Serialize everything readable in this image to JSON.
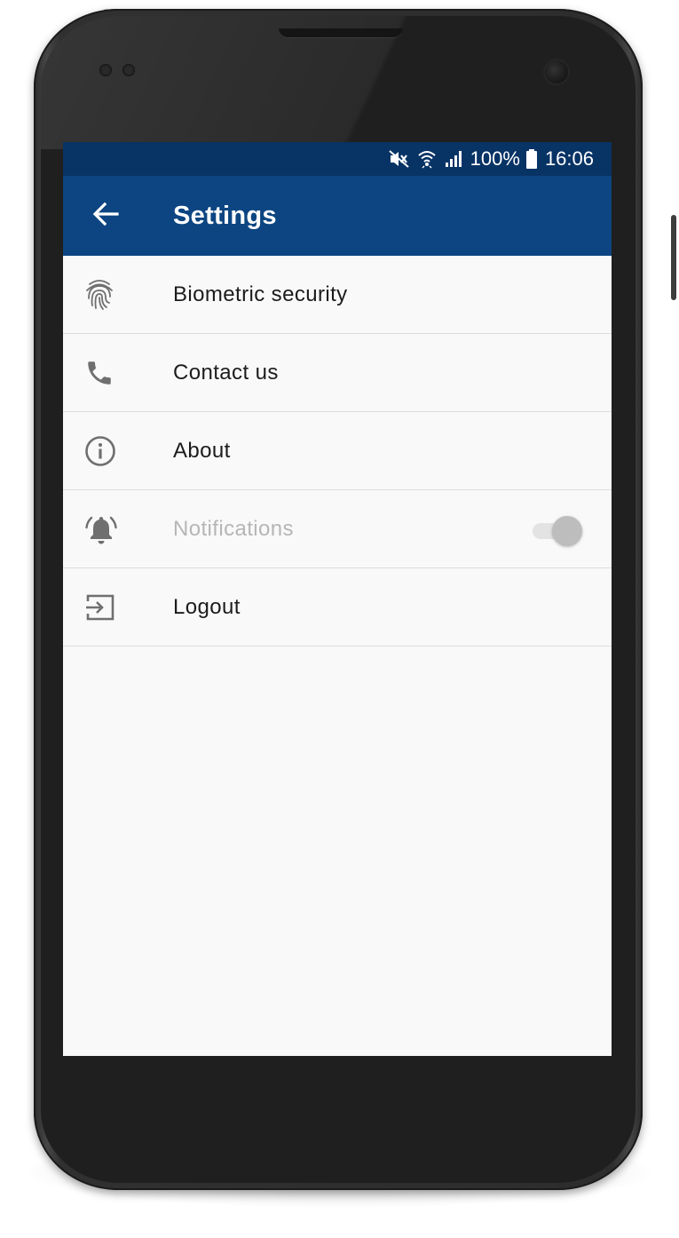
{
  "status_bar": {
    "battery": "100%",
    "time": "16:06",
    "icons": [
      "mute-icon",
      "wifi-icon",
      "signal-icon",
      "battery-icon"
    ]
  },
  "app_bar": {
    "back_icon": "arrow-back-icon",
    "title": "Settings",
    "color": "#0c4581",
    "status_color": "#083365"
  },
  "settings": {
    "items": [
      {
        "label": "Biometric security",
        "icon": "fingerprint-icon",
        "enabled": true
      },
      {
        "label": "Contact us",
        "icon": "phone-icon",
        "enabled": true
      },
      {
        "label": "About",
        "icon": "info-icon",
        "enabled": true
      },
      {
        "label": "Notifications",
        "icon": "bell-icon",
        "enabled": false,
        "toggle": "on"
      },
      {
        "label": "Logout",
        "icon": "logout-icon",
        "enabled": true
      }
    ]
  }
}
